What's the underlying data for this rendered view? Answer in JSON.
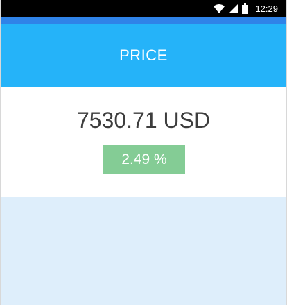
{
  "status_bar": {
    "time": "12:29",
    "icons": [
      "wifi-icon",
      "cell-signal-icon",
      "battery-icon"
    ]
  },
  "header": {
    "title": "PRICE"
  },
  "price": {
    "value": "7530.71 USD",
    "change": "2.49 %"
  },
  "colors": {
    "status_bar": "#000000",
    "accent_strip": "#2f83e8",
    "header": "#25b3f9",
    "change_badge": "#84cc95",
    "lower_area": "#deeefb",
    "price_text": "#3d3d3d"
  }
}
